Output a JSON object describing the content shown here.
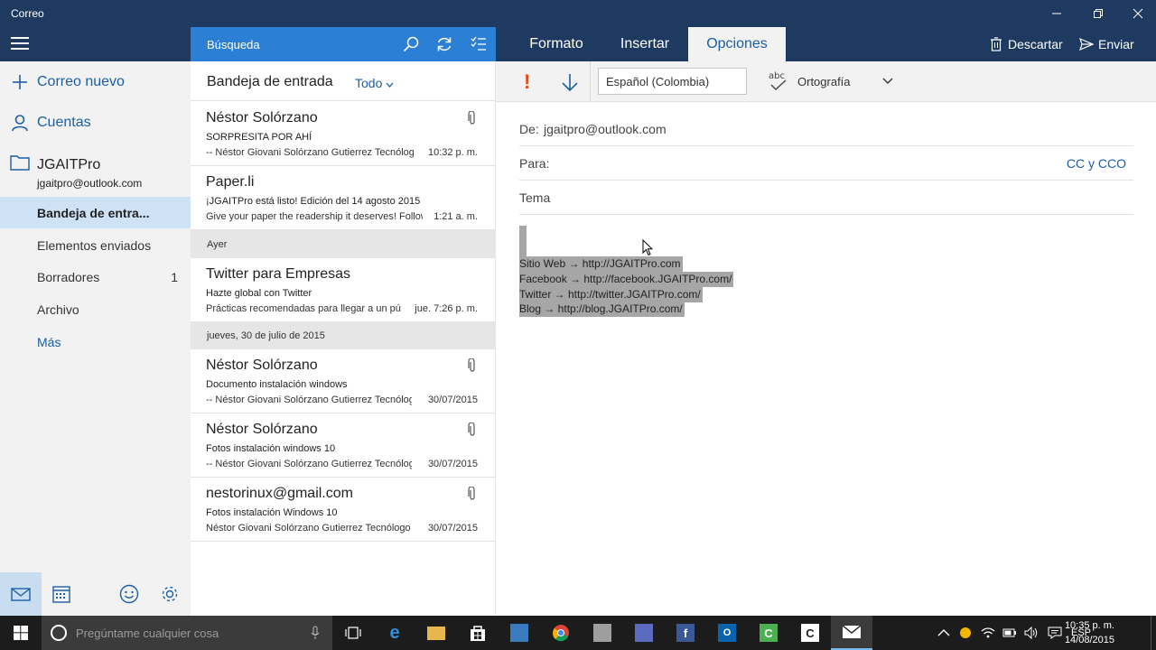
{
  "window": {
    "title": "Correo"
  },
  "left_nav": {
    "new_mail": "Correo nuevo",
    "accounts": "Cuentas",
    "account_name": "JGAITPro",
    "account_email": "jgaitpro@outlook.com",
    "folders": [
      {
        "label": "Bandeja de entra...",
        "count": ""
      },
      {
        "label": "Elementos enviados",
        "count": ""
      },
      {
        "label": "Borradores",
        "count": "1"
      },
      {
        "label": "Archivo",
        "count": ""
      },
      {
        "label": "Más",
        "count": ""
      }
    ]
  },
  "list": {
    "search_label": "Búsqueda",
    "header": "Bandeja de entrada",
    "filter": "Todo",
    "messages": [
      {
        "sender": "Néstor Solórzano",
        "subject": "SORPRESITA POR AHÍ",
        "preview": "-- Néstor Giovani Solórzano Gutierrez Tecnólogo",
        "time": "10:32 p. m."
      },
      {
        "sender": "Paper.li",
        "subject": "¡JGAITPro está listo! Edición del 14 agosto 2015",
        "preview": "Give your paper the readership it deserves! Follow",
        "time": "1:21 a. m."
      },
      {
        "sender": "Twitter para Empresas",
        "subject": "Hazte global con Twitter",
        "preview": "Prácticas recomendadas para llegar a un público",
        "time": "jue. 7:26 p. m."
      },
      {
        "sender": "Néstor Solórzano",
        "subject": "Documento instalación windows",
        "preview": "-- Néstor Giovani Solórzano Gutierrez Tecnólogo",
        "time": "30/07/2015"
      },
      {
        "sender": "Néstor Solórzano",
        "subject": "Fotos instalación windows 10",
        "preview": "--  Néstor Giovani Solórzano Gutierrez Tecnólogo",
        "time": "30/07/2015"
      },
      {
        "sender": "nestorinux@gmail.com",
        "subject": "Fotos instalación Windows 10",
        "preview": "Néstor Giovani Solórzano Gutierrez Tecnólogo",
        "time": "30/07/2015"
      }
    ],
    "groups": [
      "Ayer",
      "jueves, 30 de julio de 2015"
    ]
  },
  "compose": {
    "tabs": [
      "Formato",
      "Insertar",
      "Opciones"
    ],
    "discard": "Descartar",
    "send": "Enviar",
    "language": "Español (Colombia)",
    "spelling_abc": "abc",
    "spelling": "Ortografía",
    "from_label": "De:",
    "from_value": "jgaitpro@outlook.com",
    "to_label": "Para:",
    "cc": "CC y CCO",
    "subject_label": "Tema",
    "body_lines": [
      "Sitio Web → http://JGAITPro.com",
      "Facebook → http://facebook.JGAITPro.com/",
      "Twitter → http://twitter.JGAITPro.com/",
      "Blog → http://blog.JGAITPro.com/"
    ]
  },
  "taskbar": {
    "search_placeholder": "Pregúntame cualquier cosa",
    "language": "ESP",
    "time": "10:35 p. m.",
    "date": "14/08/2015"
  },
  "colors": {
    "titlebar": "#1f3a60",
    "search_bar": "#2b7fd4",
    "accent": "#1c5ea5",
    "selected_folder": "#cde2f5",
    "important": "#e64a19"
  }
}
